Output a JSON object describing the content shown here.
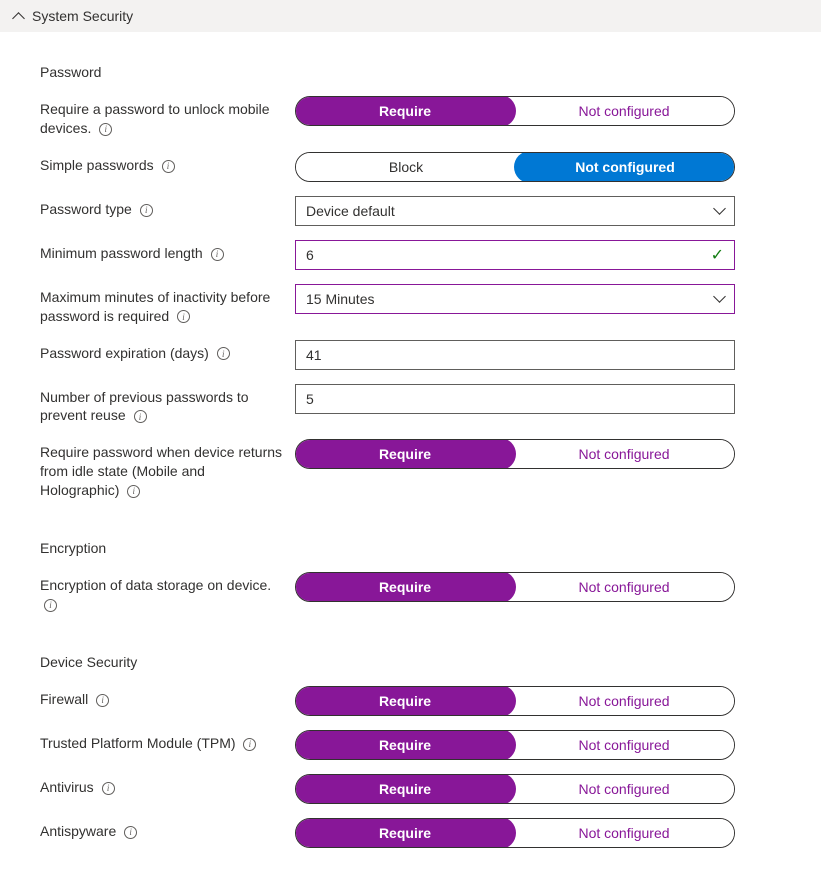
{
  "header": {
    "title": "System Security"
  },
  "sections": {
    "password": {
      "title": "Password",
      "require_unlock": {
        "label": "Require a password to unlock mobile devices.",
        "opt_require": "Require",
        "opt_notconf": "Not configured"
      },
      "simple_passwords": {
        "label": "Simple passwords",
        "opt_block": "Block",
        "opt_notconf": "Not configured"
      },
      "password_type": {
        "label": "Password type",
        "value": "Device default"
      },
      "min_length": {
        "label": "Minimum password length",
        "value": "6"
      },
      "max_inactivity": {
        "label": "Maximum minutes of inactivity before password is required",
        "value": "15 Minutes"
      },
      "expiration": {
        "label": "Password expiration (days)",
        "value": "41"
      },
      "prev_passwords": {
        "label": "Number of previous passwords to prevent reuse",
        "value": "5"
      },
      "require_idle": {
        "label": "Require password when device returns from idle state (Mobile and Holographic)",
        "opt_require": "Require",
        "opt_notconf": "Not configured"
      }
    },
    "encryption": {
      "title": "Encryption",
      "data_storage": {
        "label": "Encryption of data storage on device.",
        "opt_require": "Require",
        "opt_notconf": "Not configured"
      }
    },
    "device_security": {
      "title": "Device Security",
      "firewall": {
        "label": "Firewall",
        "opt_require": "Require",
        "opt_notconf": "Not configured"
      },
      "tpm": {
        "label": "Trusted Platform Module (TPM)",
        "opt_require": "Require",
        "opt_notconf": "Not configured"
      },
      "antivirus": {
        "label": "Antivirus",
        "opt_require": "Require",
        "opt_notconf": "Not configured"
      },
      "antispyware": {
        "label": "Antispyware",
        "opt_require": "Require",
        "opt_notconf": "Not configured"
      }
    }
  }
}
